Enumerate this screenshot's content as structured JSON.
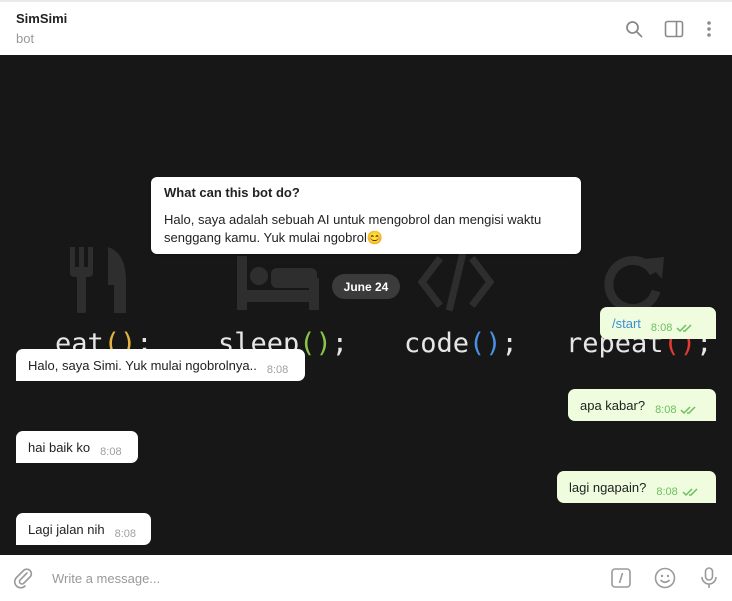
{
  "header": {
    "title": "SimSimi",
    "subtitle": "bot",
    "icons": [
      "search-icon",
      "sidebar-toggle-icon",
      "more-vertical-icon"
    ]
  },
  "wallpaper": {
    "words": [
      "eat();",
      "sleep();",
      "code();",
      "repeat();"
    ],
    "accent_colors": [
      "#e3b341",
      "#8bc34a",
      "#4a90e2",
      "#e53935"
    ]
  },
  "bot_info": {
    "title": "What can this bot do?",
    "body": "Halo, saya adalah sebuah AI untuk mengobrol dan mengisi waktu senggang kamu. Yuk mulai ngobrol😊"
  },
  "date_separator": "June 24",
  "messages": [
    {
      "dir": "out",
      "text": "/start",
      "time": "8:08",
      "read": true
    },
    {
      "dir": "in",
      "text": "Halo, saya Simi. Yuk mulai ngobrolnya..",
      "time": "8:08"
    },
    {
      "dir": "out",
      "text": "apa kabar?",
      "time": "8:08",
      "read": true
    },
    {
      "dir": "in",
      "text": "hai baik ko",
      "time": "8:08"
    },
    {
      "dir": "out",
      "text": "lagi ngapain?",
      "time": "8:08",
      "read": true
    },
    {
      "dir": "in",
      "text": "Lagi jalan nih",
      "time": "8:08"
    }
  ],
  "composer": {
    "placeholder": "Write a message...",
    "icons": [
      "paperclip-icon",
      "bot-command-icon",
      "emoji-icon",
      "microphone-icon"
    ]
  },
  "colors": {
    "outgoing_bubble": "#effdde",
    "incoming_bubble": "#ffffff",
    "chat_background": "#171717",
    "read_ticks": "#6bbf5f"
  }
}
